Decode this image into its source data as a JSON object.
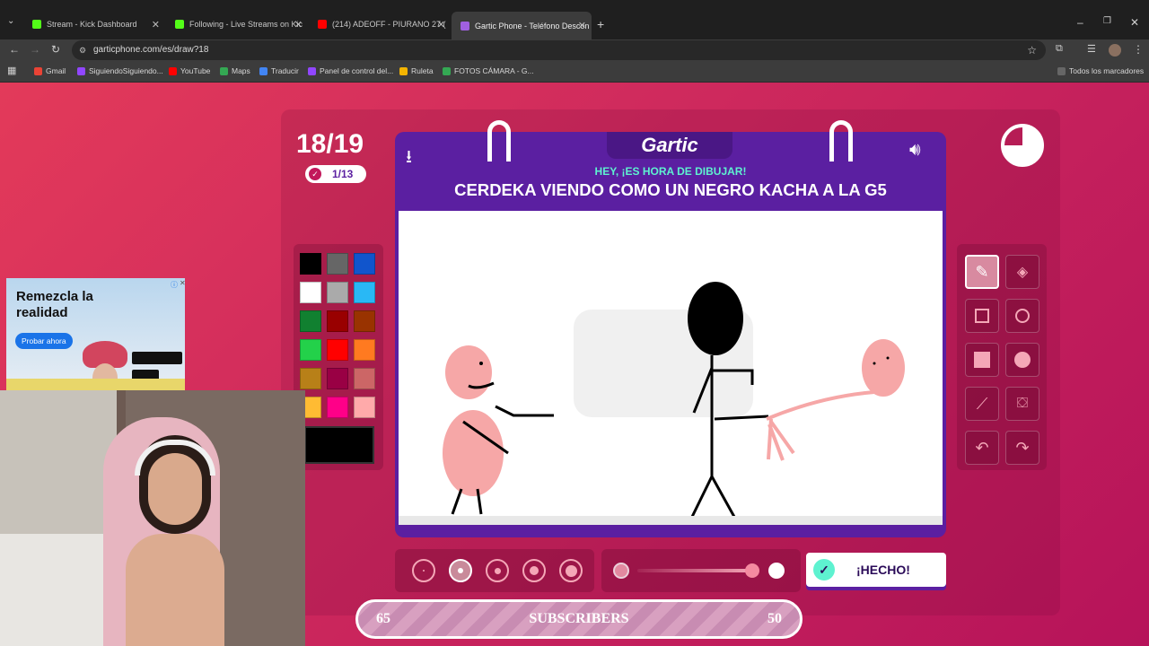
{
  "tabs": [
    {
      "title": "Stream - Kick Dashboard",
      "color": "#53fc18"
    },
    {
      "title": "Following - Live Streams on Kic",
      "color": "#53fc18"
    },
    {
      "title": "(214) ADEOFF - PIURANO 27 (",
      "color": "#ff0000"
    },
    {
      "title": "Gartic Phone - Teléfono Descon",
      "color": "#a060e0"
    }
  ],
  "url": "garticphone.com/es/draw?18",
  "bookmarks": [
    {
      "label": "Gmail",
      "color": "#ea4335"
    },
    {
      "label": "SiguiendoSiguiendo...",
      "color": "#9146ff"
    },
    {
      "label": "YouTube",
      "color": "#ff0000"
    },
    {
      "label": "Maps",
      "color": "#34a853"
    },
    {
      "label": "Traducir",
      "color": "#4285f4"
    },
    {
      "label": "Panel de control del...",
      "color": "#9146ff"
    },
    {
      "label": "Ruleta",
      "color": "#f4b400"
    },
    {
      "label": "FOTOS CÁMARA - G...",
      "color": "#34a853"
    }
  ],
  "all_bookmarks": "Todos los marcadores",
  "game": {
    "round": "18/19",
    "done_count": "1/13",
    "logo": "Gartic",
    "subtitle": "HEY, ¡ES HORA DE DIBUJAR!",
    "prompt": "CERDEKA VIENDO COMO UN NEGRO KACHA A LA G5",
    "done_button": "¡HECHO!",
    "palette": [
      "#000000",
      "#666666",
      "#1155cc",
      "#ffffff",
      "#aaaaaa",
      "#29b8f5",
      "#118030",
      "#990000",
      "#993300",
      "#23d14a",
      "#ff0000",
      "#ff7a20",
      "#b88018",
      "#990044",
      "#cc6666",
      "#ffbb33",
      "#ff0088",
      "#ffaaaa"
    ],
    "current_color": "#000000"
  },
  "ad": {
    "headline": "Remezcla la realidad",
    "cta": "Probar ahora"
  },
  "overlay": {
    "left": "65",
    "center": "SUBSCRIBERS",
    "right": "50"
  }
}
